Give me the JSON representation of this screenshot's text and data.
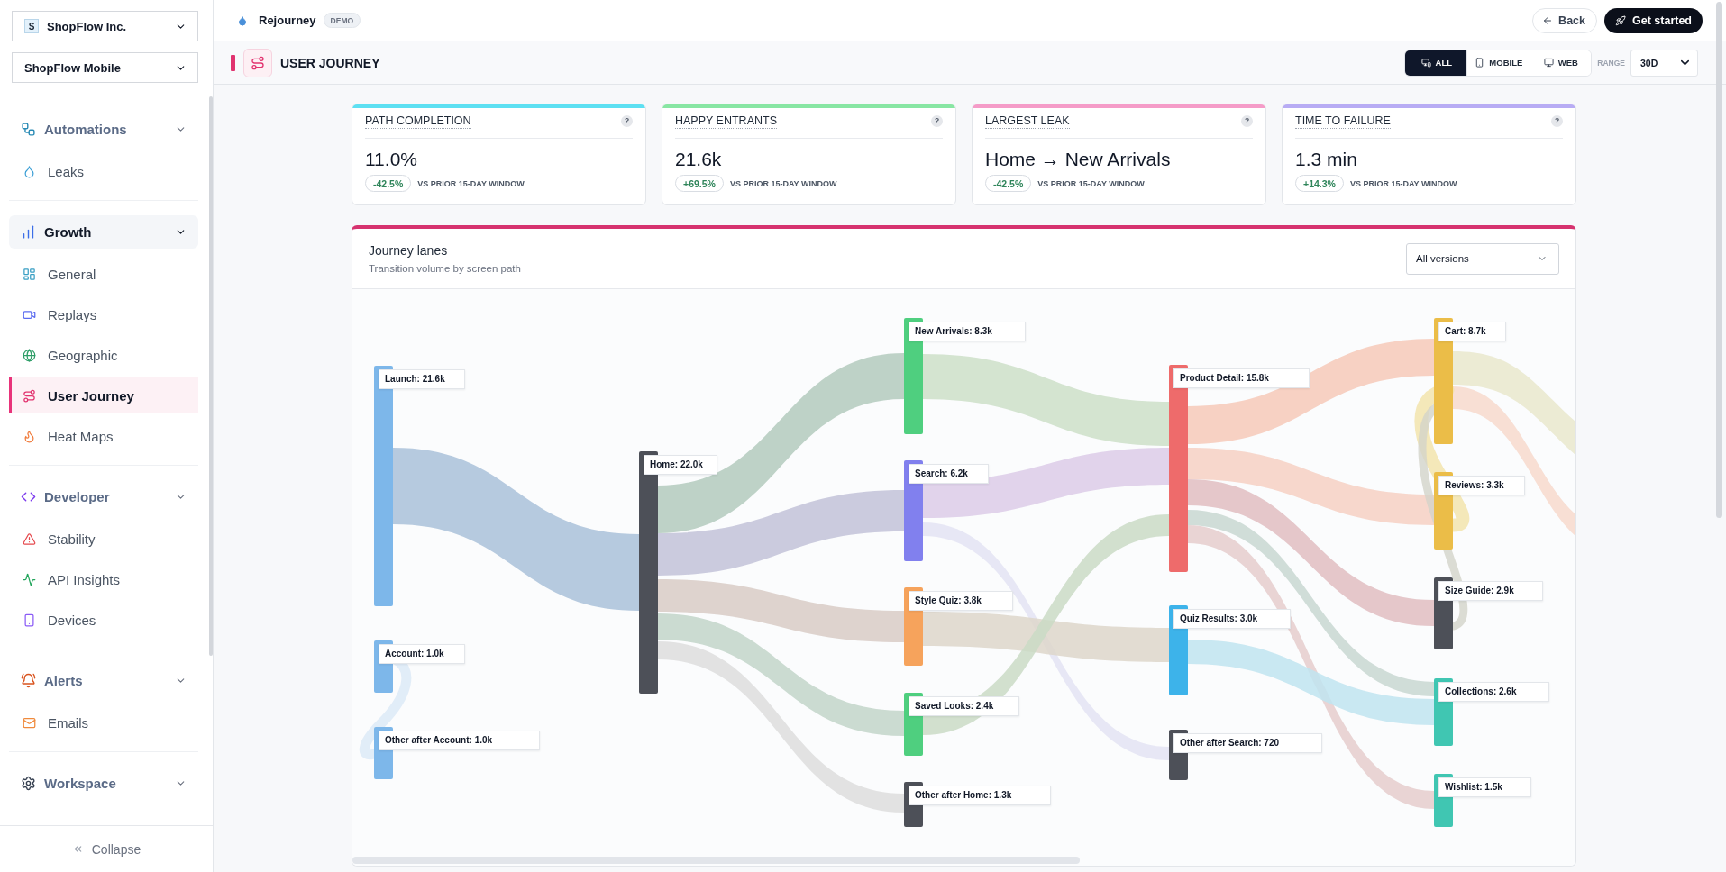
{
  "sidebar": {
    "org_select": {
      "badge": "S",
      "value": "ShopFlow Inc."
    },
    "project_select": {
      "value": "ShopFlow Mobile"
    },
    "sections": [
      {
        "title": "Automations",
        "selected": false,
        "expanded": true,
        "items": [
          {
            "label": "Leaks",
            "selected": false
          }
        ]
      },
      {
        "title": "Growth",
        "selected": true,
        "expanded": true,
        "items": [
          {
            "label": "General",
            "selected": false
          },
          {
            "label": "Replays",
            "selected": false
          },
          {
            "label": "Geographic",
            "selected": false
          },
          {
            "label": "User Journey",
            "selected": true
          },
          {
            "label": "Heat Maps",
            "selected": false
          }
        ]
      },
      {
        "title": "Developer",
        "selected": false,
        "expanded": true,
        "items": [
          {
            "label": "Stability",
            "selected": false
          },
          {
            "label": "API Insights",
            "selected": false
          },
          {
            "label": "Devices",
            "selected": false
          }
        ]
      },
      {
        "title": "Alerts",
        "selected": false,
        "expanded": true,
        "items": [
          {
            "label": "Emails",
            "selected": false
          }
        ]
      },
      {
        "title": "Workspace",
        "selected": false,
        "expanded": true
      }
    ],
    "collapse": {
      "label": "Collapse"
    }
  },
  "topbar": {
    "app_name": "Rejourney",
    "badge": "DEMO",
    "actions": [
      {
        "label": "Back",
        "kind": "secondary"
      },
      {
        "label": "Get started",
        "kind": "primary"
      }
    ]
  },
  "page_header": {
    "title": "USER JOURNEY",
    "platform_tabs": [
      {
        "label": "ALL",
        "selected": true
      },
      {
        "label": "MOBILE",
        "selected": false
      },
      {
        "label": "WEB",
        "selected": false
      }
    ],
    "range": {
      "label": "RANGE",
      "value": "30D"
    }
  },
  "kpis": [
    {
      "title": "PATH COMPLETION",
      "help": "?",
      "value": "11.0%",
      "change": "-42.5%",
      "comparison": "VS PRIOR 15-DAY WINDOW",
      "color": "#5de0f2"
    },
    {
      "title": "HAPPY ENTRANTS",
      "help": "?",
      "value": "21.6k",
      "change": "+69.5%",
      "comparison": "VS PRIOR 15-DAY WINDOW",
      "color": "#88e6a3"
    },
    {
      "title": "LARGEST LEAK",
      "help": "?",
      "value": "Home → New Arrivals",
      "change": "-42.5%",
      "comparison": "VS PRIOR 15-DAY WINDOW",
      "color": "#f59cc8"
    },
    {
      "title": "TIME TO FAILURE",
      "help": "?",
      "value": "1.3 min",
      "change": "+14.3%",
      "comparison": "VS PRIOR 15-DAY WINDOW",
      "color": "#b8acf4"
    }
  ],
  "journey": {
    "title": "Journey lanes",
    "subtitle": "Transition volume by screen path",
    "version_select": {
      "value": "All versions"
    },
    "columns": [
      {
        "nodes": [
          {
            "label": "Launch: 21.6k",
            "color": "#7db7ea"
          },
          {
            "label": "Account: 1.0k",
            "color": "#7db7ea"
          },
          {
            "label": "Other after Account: 1.0k",
            "color": "#7db7ea"
          }
        ]
      },
      {
        "nodes": [
          {
            "label": "Home: 22.0k",
            "color": "#4d5058"
          }
        ]
      },
      {
        "nodes": [
          {
            "label": "New Arrivals: 8.3k",
            "color": "#4fcf7f"
          },
          {
            "label": "Search: 6.2k",
            "color": "#8180ee"
          },
          {
            "label": "Style Quiz: 3.8k",
            "color": "#f6a35c"
          },
          {
            "label": "Saved Looks: 2.4k",
            "color": "#4fcf7f"
          },
          {
            "label": "Other after Home: 1.3k",
            "color": "#4d5058"
          }
        ]
      },
      {
        "nodes": [
          {
            "label": "Product Detail: 15.8k",
            "color": "#ee6b6b"
          },
          {
            "label": "Quiz Results: 3.0k",
            "color": "#3db3ea"
          },
          {
            "label": "Other after Search: 720",
            "color": "#4d5058"
          }
        ]
      },
      {
        "nodes": [
          {
            "label": "Cart: 8.7k",
            "color": "#ebbd48"
          },
          {
            "label": "Reviews: 3.3k",
            "color": "#ebbd48"
          },
          {
            "label": "Size Guide: 2.9k",
            "color": "#4d5058"
          },
          {
            "label": "Collections: 2.6k",
            "color": "#40c6b2"
          },
          {
            "label": "Wishlist: 1.5k",
            "color": "#40c6b2"
          }
        ]
      }
    ]
  }
}
